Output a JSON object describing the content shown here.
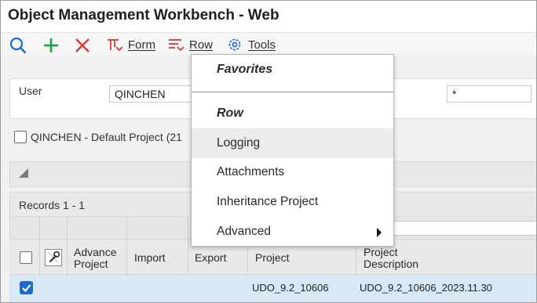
{
  "window": {
    "title": "Object Management Workbench - Web"
  },
  "toolbar": {
    "form_label": "Form",
    "row_label": "Row",
    "tools_label": "Tools",
    "search_icon": "search-icon",
    "add_icon": "plus-icon",
    "delete_icon": "close-icon",
    "accent_color": "#1b6ad0"
  },
  "header": {
    "user_label": "User",
    "user_value": "QINCHEN",
    "filter_value": "*"
  },
  "project": {
    "label": "QINCHEN - Default Project (21"
  },
  "grid": {
    "records": "Records 1 - 1",
    "columns": {
      "advance_project": [
        "Advance",
        "Project"
      ],
      "import": "Import",
      "export": "Export",
      "project": "Project",
      "project_description": [
        "Project",
        "Description"
      ]
    },
    "rows": [
      {
        "selected": true,
        "project": "UDO_9.2_10606",
        "description": "UDO_9.2_10606_2023.11.30"
      }
    ]
  },
  "dropdown": {
    "favorites_header": "Favorites",
    "row_header": "Row",
    "items": [
      {
        "label": "Logging",
        "highlighted": true
      },
      {
        "label": "Attachments"
      },
      {
        "label": "Inheritance Project"
      },
      {
        "label": "Advanced",
        "has_submenu": true
      }
    ]
  }
}
